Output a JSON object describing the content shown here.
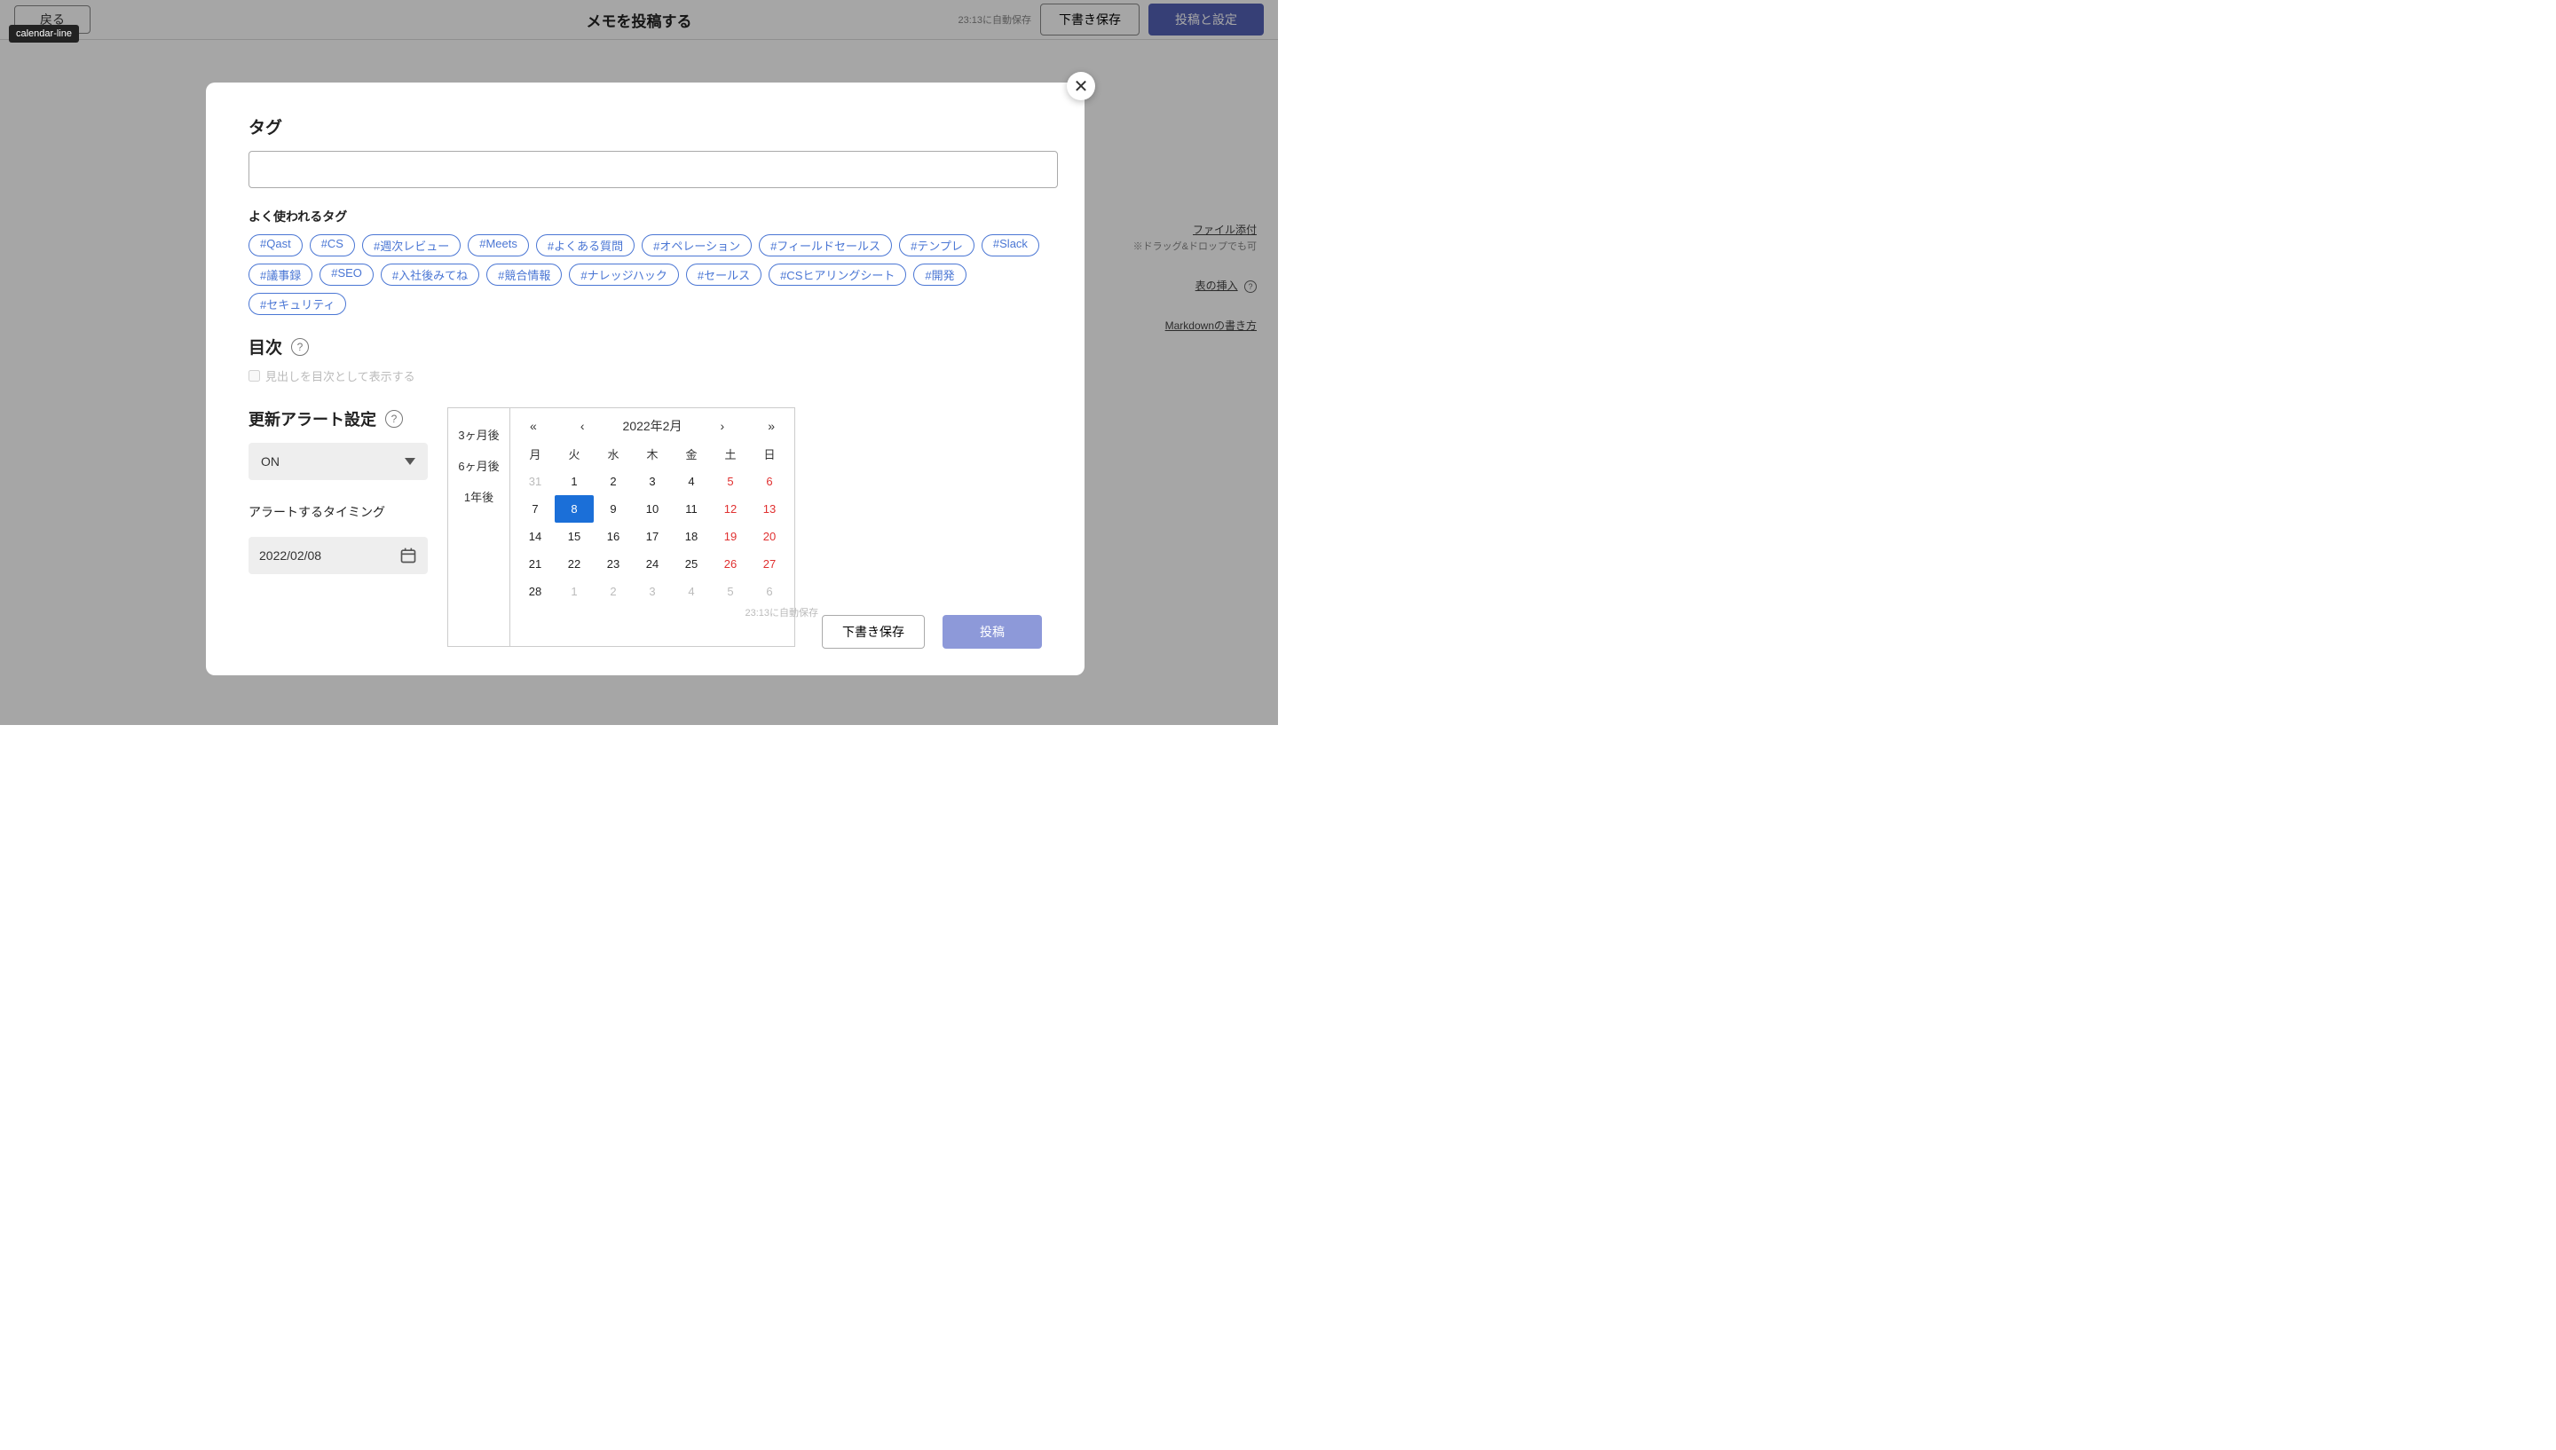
{
  "tooltip": "calendar-line",
  "topbar": {
    "back": "戻る",
    "title": "メモを投稿する",
    "autosave": "23:13に自動保存",
    "draft": "下書き保存",
    "publish": "投稿と設定"
  },
  "side": {
    "file_attach": "ファイル添付",
    "file_hint": "※ドラッグ&ドロップでも可",
    "table_insert": "表の挿入",
    "markdown": "Markdownの書き方"
  },
  "modal": {
    "tag_title": "タグ",
    "freq_label": "よく使われるタグ",
    "tags_row1": [
      "#Qast",
      "#CS",
      "#週次レビュー",
      "#Meets",
      "#よくある質問",
      "#オペレーション",
      "#フィールドセールス",
      "#テンプレ",
      "#Slack"
    ],
    "tags_row2": [
      "#議事録",
      "#SEO",
      "#入社後みてね",
      "#競合情報",
      "#ナレッジハック",
      "#セールス",
      "#CSヒアリングシート",
      "#開発",
      "#セキュリティ"
    ],
    "toc_title": "目次",
    "toc_check": "見出しを目次として表示する",
    "alert_title": "更新アラート設定",
    "on_label": "ON",
    "timing_label": "アラートするタイミング",
    "date_value": "2022/02/08",
    "presets": [
      "3ヶ月後",
      "6ヶ月後",
      "1年後"
    ],
    "cal": {
      "month": "2022年2月",
      "nav": {
        "first": "«",
        "prev": "‹",
        "next": "›",
        "last": "»"
      },
      "dow": [
        "月",
        "火",
        "水",
        "木",
        "金",
        "土",
        "日"
      ],
      "weeks": [
        [
          {
            "n": "31",
            "cls": "out"
          },
          {
            "n": "1"
          },
          {
            "n": "2"
          },
          {
            "n": "3"
          },
          {
            "n": "4"
          },
          {
            "n": "5",
            "cls": "wk"
          },
          {
            "n": "6",
            "cls": "wk"
          }
        ],
        [
          {
            "n": "7"
          },
          {
            "n": "8",
            "cls": "sel"
          },
          {
            "n": "9"
          },
          {
            "n": "10"
          },
          {
            "n": "11"
          },
          {
            "n": "12",
            "cls": "wk"
          },
          {
            "n": "13",
            "cls": "wk"
          }
        ],
        [
          {
            "n": "14"
          },
          {
            "n": "15"
          },
          {
            "n": "16"
          },
          {
            "n": "17"
          },
          {
            "n": "18"
          },
          {
            "n": "19",
            "cls": "wk"
          },
          {
            "n": "20",
            "cls": "wk"
          }
        ],
        [
          {
            "n": "21"
          },
          {
            "n": "22"
          },
          {
            "n": "23"
          },
          {
            "n": "24"
          },
          {
            "n": "25"
          },
          {
            "n": "26",
            "cls": "wk"
          },
          {
            "n": "27",
            "cls": "wk"
          }
        ],
        [
          {
            "n": "28"
          },
          {
            "n": "1",
            "cls": "out"
          },
          {
            "n": "2",
            "cls": "out"
          },
          {
            "n": "3",
            "cls": "out"
          },
          {
            "n": "4",
            "cls": "out"
          },
          {
            "n": "5",
            "cls": "out"
          },
          {
            "n": "6",
            "cls": "out"
          }
        ]
      ]
    },
    "autosave": "23:13に自動保存",
    "draft": "下書き保存",
    "submit": "投稿"
  }
}
